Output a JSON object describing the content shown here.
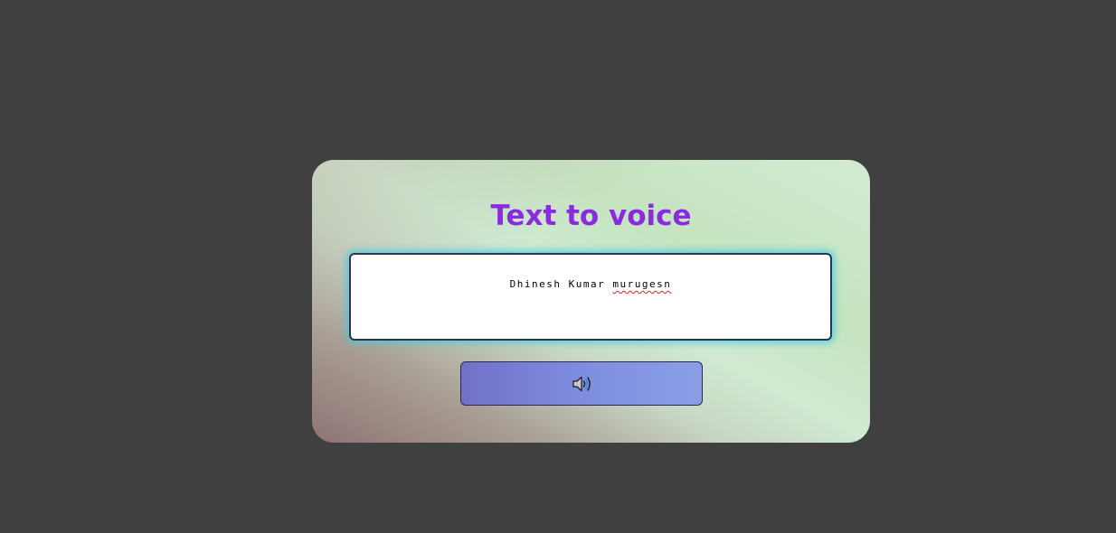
{
  "app": {
    "title": "Text to voice"
  },
  "input": {
    "value_parts": [
      "Dhinesh Kumar ",
      "murugesn"
    ],
    "misspelled_word": "murugesn"
  },
  "speak_button": {
    "icon": "speaker-icon"
  },
  "colors": {
    "background": "#404040",
    "title": "#8a2be2",
    "input_glow": "#40c8e6",
    "button_start": "#7270c8",
    "button_end": "#8a9ee6"
  }
}
